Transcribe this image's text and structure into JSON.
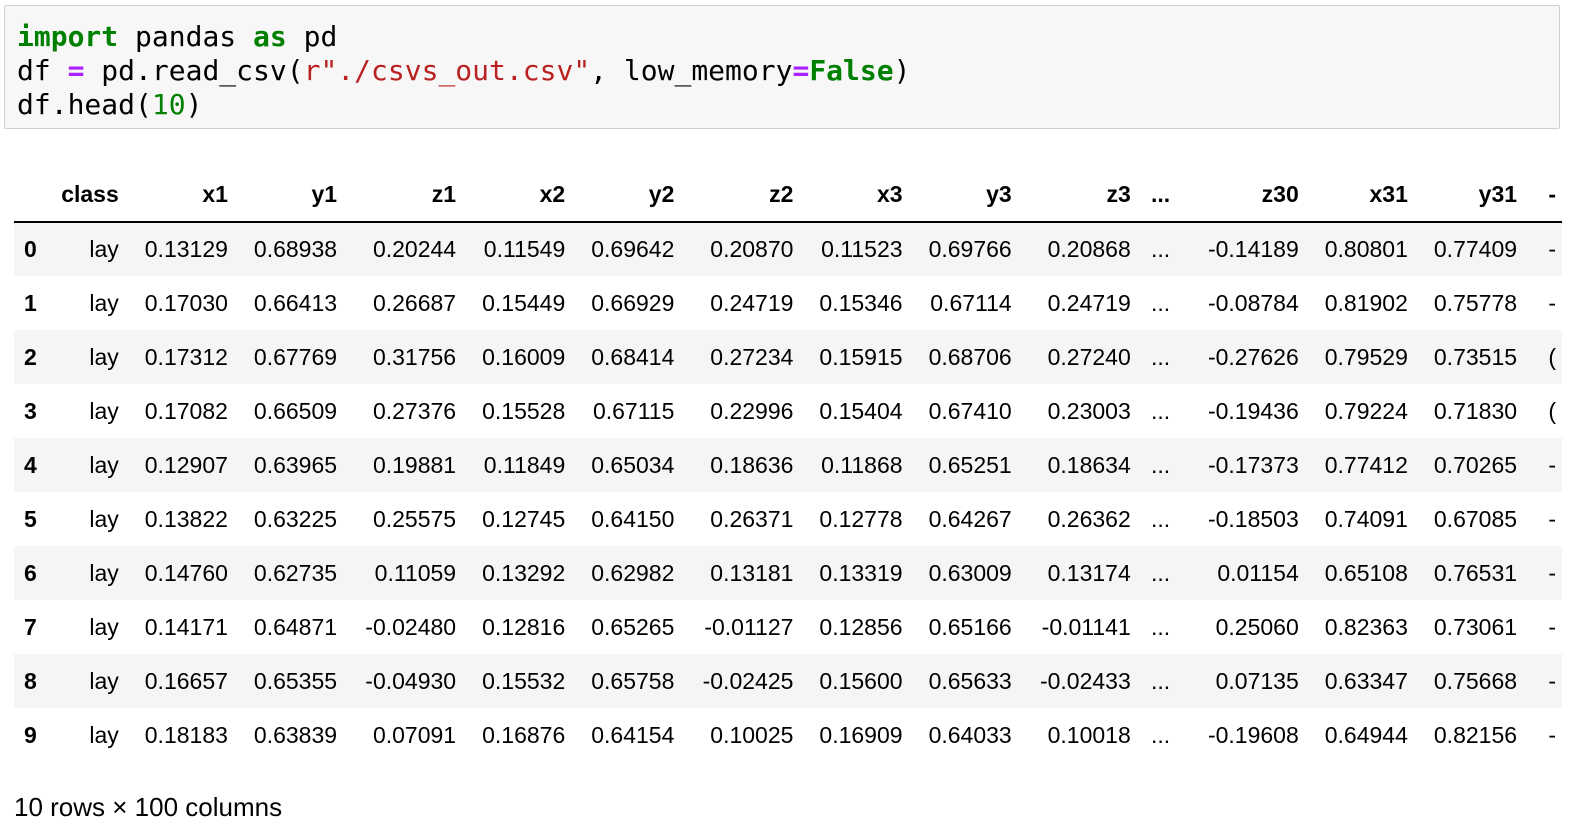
{
  "code": {
    "line1": {
      "kw1": "import",
      "mid": " pandas ",
      "kw2": "as",
      "end": " pd"
    },
    "line2": {
      "a": "df ",
      "op1": "=",
      "b": " pd.read_csv(",
      "str": "r\"./csvs_out.csv\"",
      "c": ", low_memory",
      "op2": "=",
      "kw": "False",
      "d": ")"
    },
    "line3": {
      "a": "df.head(",
      "num": "10",
      "b": ")"
    }
  },
  "table": {
    "columns": [
      "class",
      "x1",
      "y1",
      "z1",
      "x2",
      "y2",
      "z2",
      "x3",
      "y3",
      "z3",
      "...",
      "z30",
      "x31",
      "y31",
      "-"
    ],
    "rows": [
      {
        "index": "0",
        "cells": [
          "lay",
          "0.13129",
          "0.68938",
          "0.20244",
          "0.11549",
          "0.69642",
          "0.20870",
          "0.11523",
          "0.69766",
          "0.20868",
          "...",
          "-0.14189",
          "0.80801",
          "0.77409",
          "-"
        ]
      },
      {
        "index": "1",
        "cells": [
          "lay",
          "0.17030",
          "0.66413",
          "0.26687",
          "0.15449",
          "0.66929",
          "0.24719",
          "0.15346",
          "0.67114",
          "0.24719",
          "...",
          "-0.08784",
          "0.81902",
          "0.75778",
          "-"
        ]
      },
      {
        "index": "2",
        "cells": [
          "lay",
          "0.17312",
          "0.67769",
          "0.31756",
          "0.16009",
          "0.68414",
          "0.27234",
          "0.15915",
          "0.68706",
          "0.27240",
          "...",
          "-0.27626",
          "0.79529",
          "0.73515",
          "("
        ]
      },
      {
        "index": "3",
        "cells": [
          "lay",
          "0.17082",
          "0.66509",
          "0.27376",
          "0.15528",
          "0.67115",
          "0.22996",
          "0.15404",
          "0.67410",
          "0.23003",
          "...",
          "-0.19436",
          "0.79224",
          "0.71830",
          "("
        ]
      },
      {
        "index": "4",
        "cells": [
          "lay",
          "0.12907",
          "0.63965",
          "0.19881",
          "0.11849",
          "0.65034",
          "0.18636",
          "0.11868",
          "0.65251",
          "0.18634",
          "...",
          "-0.17373",
          "0.77412",
          "0.70265",
          "-"
        ]
      },
      {
        "index": "5",
        "cells": [
          "lay",
          "0.13822",
          "0.63225",
          "0.25575",
          "0.12745",
          "0.64150",
          "0.26371",
          "0.12778",
          "0.64267",
          "0.26362",
          "...",
          "-0.18503",
          "0.74091",
          "0.67085",
          "-"
        ]
      },
      {
        "index": "6",
        "cells": [
          "lay",
          "0.14760",
          "0.62735",
          "0.11059",
          "0.13292",
          "0.62982",
          "0.13181",
          "0.13319",
          "0.63009",
          "0.13174",
          "...",
          "0.01154",
          "0.65108",
          "0.76531",
          "-"
        ]
      },
      {
        "index": "7",
        "cells": [
          "lay",
          "0.14171",
          "0.64871",
          "-0.02480",
          "0.12816",
          "0.65265",
          "-0.01127",
          "0.12856",
          "0.65166",
          "-0.01141",
          "...",
          "0.25060",
          "0.82363",
          "0.73061",
          "-"
        ]
      },
      {
        "index": "8",
        "cells": [
          "lay",
          "0.16657",
          "0.65355",
          "-0.04930",
          "0.15532",
          "0.65758",
          "-0.02425",
          "0.15600",
          "0.65633",
          "-0.02433",
          "...",
          "0.07135",
          "0.63347",
          "0.75668",
          "-"
        ]
      },
      {
        "index": "9",
        "cells": [
          "lay",
          "0.18183",
          "0.63839",
          "0.07091",
          "0.16876",
          "0.64154",
          "0.10025",
          "0.16909",
          "0.64033",
          "0.10018",
          "...",
          "-0.19608",
          "0.64944",
          "0.82156",
          "-"
        ]
      }
    ]
  },
  "footer": "10 rows × 100 columns"
}
